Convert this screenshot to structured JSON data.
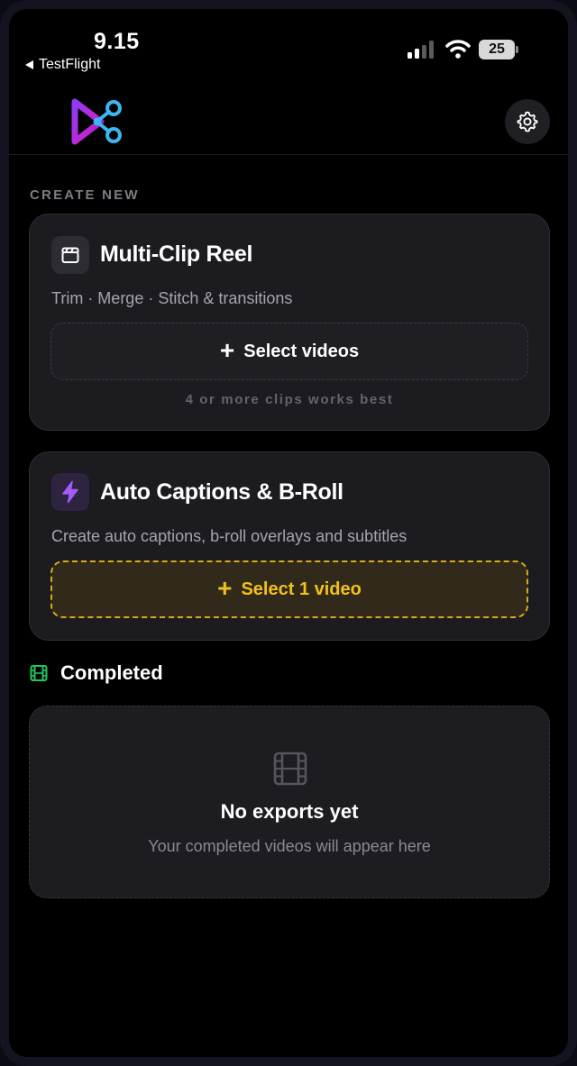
{
  "status_bar": {
    "time": "9.15",
    "back_app_label": "TestFlight",
    "battery_level": "25",
    "signal_icon": "cellular-signal-icon",
    "wifi_icon": "wifi-icon"
  },
  "header": {
    "logo_icon": "app-logo-icon",
    "settings_icon": "gear-icon"
  },
  "create_section": {
    "label": "CREATE NEW"
  },
  "multi_clip_card": {
    "icon": "clapperboard-icon",
    "title": "Multi-Clip Reel",
    "description": "Trim · Merge · Stitch & transitions",
    "button_label": "Select videos",
    "hint": "4 or more clips works best"
  },
  "captions_card": {
    "icon": "lightning-icon",
    "title": "Auto Captions & B-Roll",
    "description": "Create auto captions, b-roll overlays and subtitles",
    "button_label": "Select 1 video"
  },
  "completed_section": {
    "icon": "film-icon",
    "title": "Completed",
    "empty_icon": "film-strip-icon",
    "empty_title": "No exports yet",
    "empty_subtitle": "Your completed videos will appear here"
  },
  "colors": {
    "background": "#000000",
    "card": "#1b1b20",
    "accent_yellow": "#f1c21b",
    "accent_purple": "#9b5cf6",
    "accent_green": "#22c55e",
    "muted_text": "#a5a5ae"
  }
}
